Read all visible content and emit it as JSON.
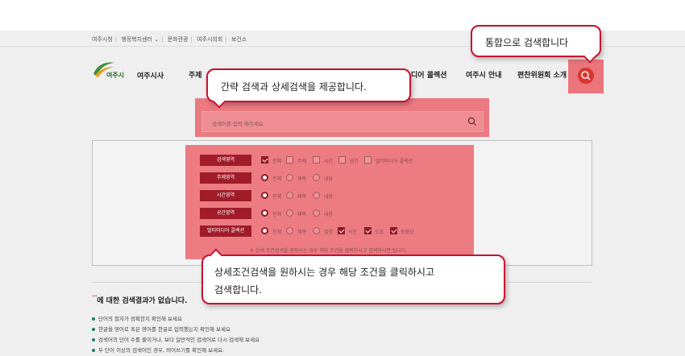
{
  "util_links": [
    "여주시청",
    "행정복지센터",
    "문화관광",
    "여주시의회",
    "보건소"
  ],
  "util_dropdown_glyph": "⌄",
  "logo": {
    "mark_text": "여주시",
    "name": "여주시사"
  },
  "gnb": [
    "주제",
    "디어 콜렉션",
    "여주시 안내",
    "편찬위원회 소개"
  ],
  "search": {
    "placeholder": "검색어를 입력 해주세요"
  },
  "filters": [
    {
      "label": "검색영역",
      "type": "checkbox",
      "options": [
        {
          "text": "전체",
          "on": true
        },
        {
          "text": "주제",
          "on": false
        },
        {
          "text": "시간",
          "on": false
        },
        {
          "text": "공간",
          "on": false
        },
        {
          "text": "멀티미디어 콜렉션",
          "on": false
        }
      ]
    },
    {
      "label": "주제영역",
      "type": "radio",
      "options": [
        {
          "text": "전체",
          "on": true
        },
        {
          "text": "제목",
          "on": false
        },
        {
          "text": "내용",
          "on": false
        }
      ]
    },
    {
      "label": "시간영역",
      "type": "radio",
      "options": [
        {
          "text": "전체",
          "on": true
        },
        {
          "text": "제목",
          "on": false
        },
        {
          "text": "내용",
          "on": false
        }
      ]
    },
    {
      "label": "공간영역",
      "type": "radio",
      "options": [
        {
          "text": "전체",
          "on": true
        },
        {
          "text": "제목",
          "on": false
        },
        {
          "text": "내용",
          "on": false
        }
      ]
    },
    {
      "label": "멀티미디어 콜렉션",
      "type": "mixed",
      "options": [
        {
          "text": "전체",
          "on": true,
          "kind": "radio"
        },
        {
          "text": "제목",
          "on": false,
          "kind": "radio"
        },
        {
          "text": "설명",
          "on": false,
          "kind": "radio"
        },
        {
          "text": "사진",
          "on": true,
          "kind": "check"
        },
        {
          "text": "도표",
          "on": true,
          "kind": "check"
        },
        {
          "text": "동영상",
          "on": true,
          "kind": "check"
        }
      ]
    }
  ],
  "filter_note": "※ 상세 조건검색을 원하시는 경우 해당 조건을 클릭하시고 검색하시면 됩니다.",
  "result": {
    "query_mark": "\"\"",
    "title": "에 대한 검색결과가 없습니다.",
    "tips": [
      "단어의 철자가 정확한지 확인해 보세요",
      "한글을 영어로 혹은 영어를 한글로 입력했는지 확인해 보세요",
      "검색어의 단어 수를 줄이거나, 보다 일반적인 검색어로 다시 검색해 보세요",
      "두 단어 이상의 검색어인 경우, 띄어쓰기를 확인해 보세요."
    ]
  },
  "callouts": {
    "top_right": "통합으로 검색합니다",
    "search": "간략 검색과 상세검색을 제공합니다.",
    "filters_line1": "상세조건검색을 원하시는 경우 해당 조건을 클릭하시고",
    "filters_line2": "검색합니다."
  },
  "colors": {
    "accent": "#c8102e",
    "label_bg": "#a01c2a",
    "highlight": "#e9424d"
  }
}
